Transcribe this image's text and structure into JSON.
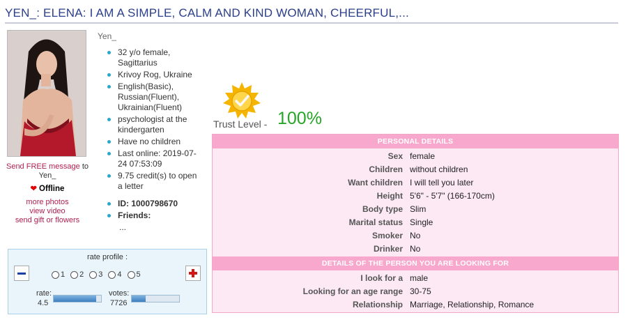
{
  "title": "YEN_: ELENA: I AM A SIMPLE, CALM AND KIND WOMAN, CHEERFUL,...",
  "profile": {
    "username": "Yen_",
    "facts": [
      "32 y/o female, Sagittarius",
      "Krivoy Rog, Ukraine",
      "English(Basic), Russian(Fluent), Ukrainian(Fluent)",
      "psychologist at the kindergarten",
      "Have no children",
      "Last online: 2019-07-24 07:53:09",
      "9.75 credit(s) to open a letter"
    ],
    "id_label": "ID: 1000798670",
    "friends_label": "Friends:",
    "friends_more": "..."
  },
  "left": {
    "send_message": "Send FREE message",
    "send_to": "to",
    "send_name": "Yen_",
    "status": "Offline",
    "more_photos": "more photos",
    "view_video": "view video",
    "send_gift": "send gift or flowers"
  },
  "trust": {
    "label": "Trust Level -",
    "value": "100%"
  },
  "personal": {
    "header": "PERSONAL DETAILS",
    "rows": [
      {
        "k": "Sex",
        "v": "female"
      },
      {
        "k": "Children",
        "v": "without children"
      },
      {
        "k": "Want children",
        "v": "I will tell you later"
      },
      {
        "k": "Height",
        "v": "5'6\" - 5'7\" (166-170cm)"
      },
      {
        "k": "Body type",
        "v": "Slim"
      },
      {
        "k": "Marital status",
        "v": "Single"
      },
      {
        "k": "Smoker",
        "v": "No"
      },
      {
        "k": "Drinker",
        "v": "No"
      }
    ]
  },
  "looking": {
    "header": "DETAILS OF THE PERSON YOU ARE LOOKING FOR",
    "rows": [
      {
        "k": "I look for a",
        "v": "male"
      },
      {
        "k": "Looking for an age range",
        "v": "30-75"
      },
      {
        "k": "Relationship",
        "v": "Marriage, Relationship, Romance"
      }
    ]
  },
  "rating": {
    "title": "rate profile :",
    "options": [
      "1",
      "2",
      "3",
      "4",
      "5"
    ],
    "rate_label": "rate:",
    "rate_value": "4.5",
    "rate_fraction": 0.9,
    "votes_label": "votes:",
    "votes_value": "7726",
    "votes_fraction": 0.3
  },
  "icons": {
    "heart": "heart-icon",
    "medal": "trust-medal-icon",
    "minus": "minus-icon",
    "plus": "plus-icon"
  },
  "colors": {
    "title": "#2b3f8a",
    "section_header": "#f9a8cd",
    "row_bg": "#fce9f3",
    "trust_value": "#26a626",
    "link": "#b02050"
  }
}
